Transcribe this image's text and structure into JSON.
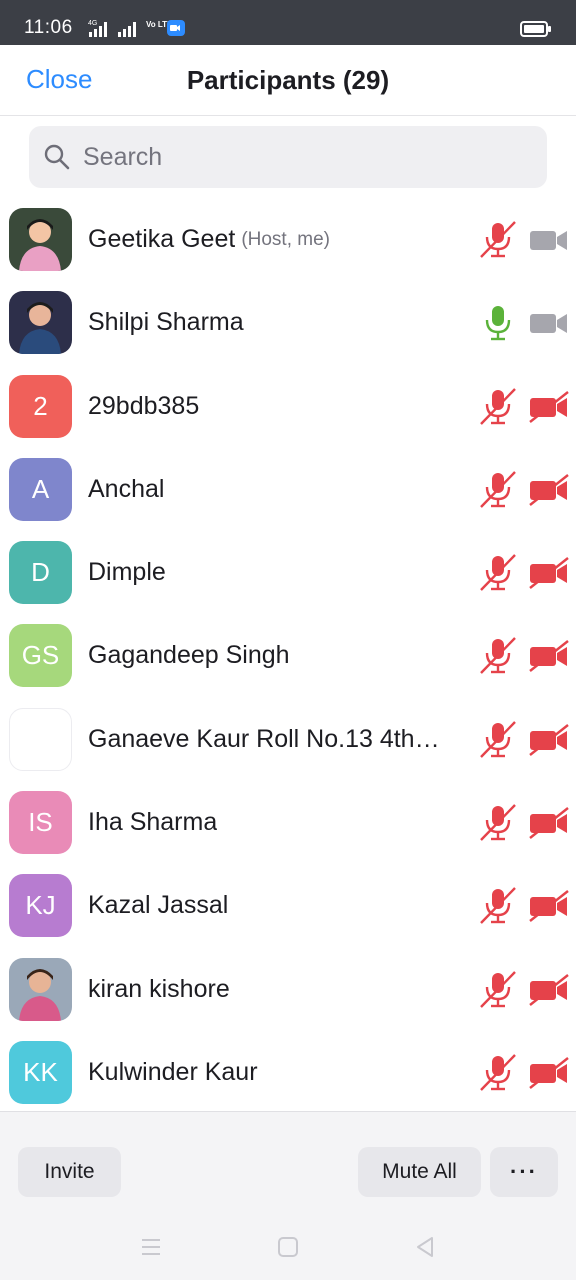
{
  "status_bar": {
    "time": "11:06",
    "network": "4G",
    "volte": "Vo LTE",
    "icons": [
      "signal-icon",
      "zoom-app-icon",
      "battery-icon"
    ]
  },
  "header": {
    "close_label": "Close",
    "title": "Participants (29)"
  },
  "search": {
    "placeholder": "Search"
  },
  "colors": {
    "accent": "#2d8cff",
    "muted_red": "#e5424a",
    "mic_active": "#5bb23a",
    "icon_gray": "#a6a6ad"
  },
  "participants": [
    {
      "name": "Geetika Geet",
      "role": "(Host, me)",
      "avatar": "photo",
      "mic": "muted",
      "video": "on"
    },
    {
      "name": "Shilpi Sharma",
      "role": "",
      "avatar": "photo",
      "mic": "active",
      "video": "on"
    },
    {
      "name": "29bdb385",
      "role": "",
      "initials": "2",
      "avatar_color": "#f0605a",
      "mic": "muted",
      "video": "off"
    },
    {
      "name": "Anchal",
      "role": "",
      "initials": "A",
      "avatar_color": "#7f86cc",
      "mic": "muted",
      "video": "off"
    },
    {
      "name": "Dimple",
      "role": "",
      "initials": "D",
      "avatar_color": "#4db6ac",
      "mic": "muted",
      "video": "off"
    },
    {
      "name": "Gagandeep Singh",
      "role": "",
      "initials": "GS",
      "avatar_color": "#a6d87c",
      "mic": "muted",
      "video": "off"
    },
    {
      "name": "Ganaeve Kaur Roll No.13 4th…",
      "role": "",
      "initials": "",
      "avatar_color": "#ffffff",
      "mic": "muted",
      "video": "off"
    },
    {
      "name": "Iha Sharma",
      "role": "",
      "initials": "IS",
      "avatar_color": "#e98bb7",
      "mic": "muted",
      "video": "off"
    },
    {
      "name": "Kazal Jassal",
      "role": "",
      "initials": "KJ",
      "avatar_color": "#b77cd0",
      "mic": "muted",
      "video": "off"
    },
    {
      "name": "kiran kishore",
      "role": "",
      "avatar": "photo",
      "mic": "muted",
      "video": "off"
    },
    {
      "name": "Kulwinder Kaur",
      "role": "",
      "initials": "KK",
      "avatar_color": "#4fc9dc",
      "mic": "muted",
      "video": "off"
    }
  ],
  "footer": {
    "invite_label": "Invite",
    "mute_all_label": "Mute All",
    "more_label": "···"
  }
}
